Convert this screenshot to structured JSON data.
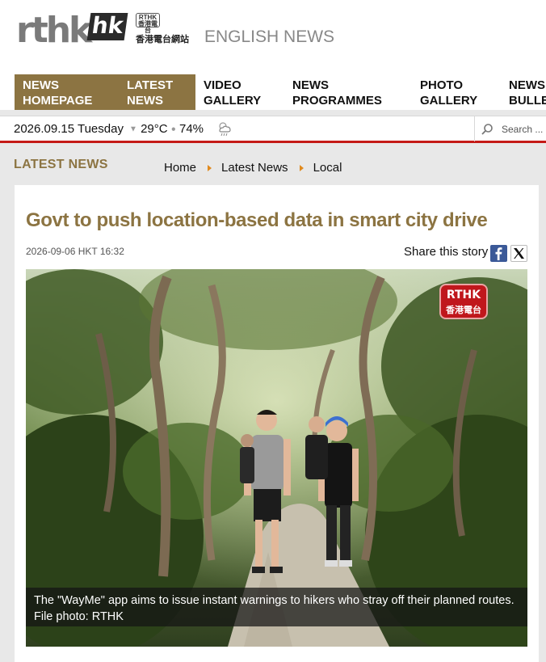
{
  "header": {
    "logo_text": "rthk",
    "logo_suffix": "hk",
    "logo_badge": "RTHK 香港電台",
    "logo_chinese": "香港電台網站",
    "section_name": "ENGLISH NEWS"
  },
  "nav": {
    "items": [
      {
        "label": "NEWS HOMEPAGE",
        "active": true
      },
      {
        "label": "LATEST NEWS",
        "active": true
      },
      {
        "label": "VIDEO GALLERY",
        "active": false
      },
      {
        "label": "NEWS PROGRAMMES",
        "active": false
      },
      {
        "label": "PHOTO GALLERY",
        "active": false
      },
      {
        "label": "NEWS BULLE",
        "active": false
      }
    ]
  },
  "infobar": {
    "date": "2026.09.15 Tuesday",
    "temperature": "29°C",
    "humidity": "74%",
    "weather_icon": "partly-cloudy-rain-icon",
    "search_placeholder": "Search ..."
  },
  "section": {
    "title": "LATEST NEWS",
    "breadcrumb": [
      "Home",
      "Latest News",
      "Local"
    ]
  },
  "article": {
    "headline": "Govt to push location-based data in smart city drive",
    "timestamp": "2026-09-06 HKT 16:32",
    "share_label": "Share this story",
    "photo_logo_line1": "RTHK",
    "photo_logo_line2": "香港電台",
    "caption": "The \"WayMe\" app aims to issue instant warnings to hikers who stray off their planned routes. File photo: RTHK"
  },
  "colors": {
    "accent_gold": "#8c7442",
    "divider_red": "#c41a17",
    "breadcrumb_arrow": "#e08a1e",
    "facebook_blue": "#3b5998"
  }
}
